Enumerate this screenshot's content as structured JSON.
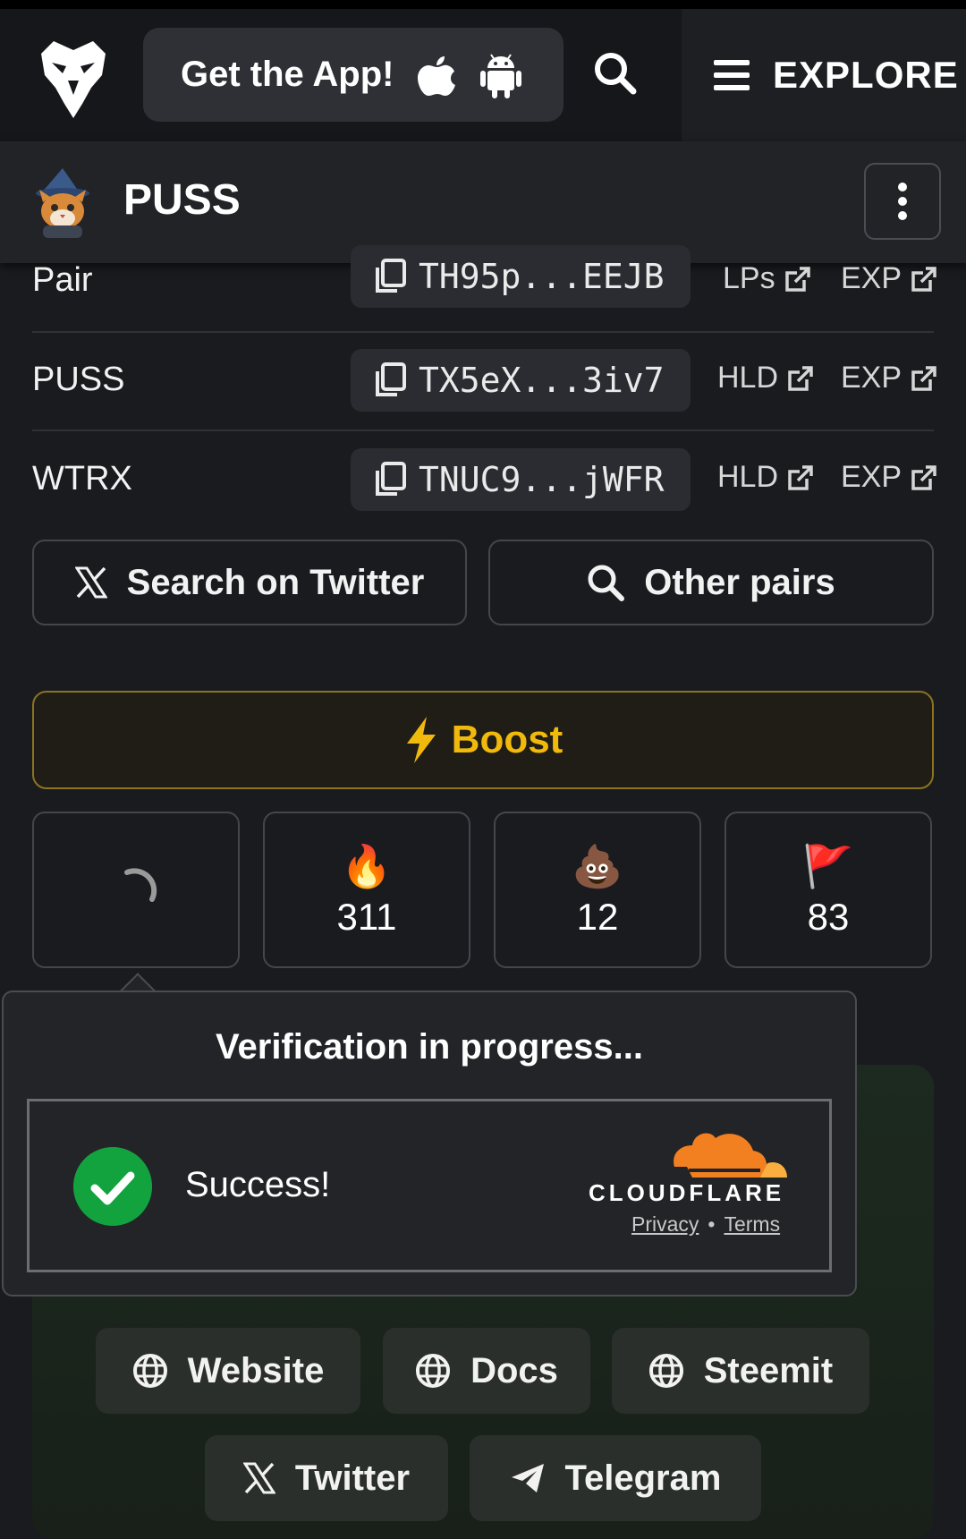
{
  "header": {
    "get_app_label": "Get the App!",
    "explore_label": "EXPLORE"
  },
  "token": {
    "name": "PUSS"
  },
  "addresses": [
    {
      "name": "Pair",
      "address": "TH95p...EEJB",
      "link1": "LPs",
      "link2": "EXP"
    },
    {
      "name": "PUSS",
      "address": "TX5eX...3iv7",
      "link1": "HLD",
      "link2": "EXP"
    },
    {
      "name": "WTRX",
      "address": "TNUC9...jWFR",
      "link1": "HLD",
      "link2": "EXP"
    }
  ],
  "actions": {
    "twitter_search_label": "Search on Twitter",
    "other_pairs_label": "Other pairs",
    "boost_label": "Boost"
  },
  "reactions": [
    {
      "emoji": "",
      "count": ""
    },
    {
      "emoji": "🔥",
      "count": "311"
    },
    {
      "emoji": "💩",
      "count": "12"
    },
    {
      "emoji": "🚩",
      "count": "83"
    }
  ],
  "verification": {
    "title": "Verification in progress...",
    "status": "Success!",
    "provider": "CLOUDFLARE",
    "privacy_label": "Privacy",
    "separator": "•",
    "terms_label": "Terms"
  },
  "socials": [
    {
      "label": "Website",
      "icon": "globe-icon"
    },
    {
      "label": "Docs",
      "icon": "globe-icon"
    },
    {
      "label": "Steemit",
      "icon": "globe-icon"
    },
    {
      "label": "Twitter",
      "icon": "x-icon"
    },
    {
      "label": "Telegram",
      "icon": "telegram-icon"
    }
  ],
  "colors": {
    "background": "#1a1b1f",
    "boost_accent": "#f0b90b",
    "success_green": "#12a33e",
    "cloudflare_orange": "#f38020"
  }
}
